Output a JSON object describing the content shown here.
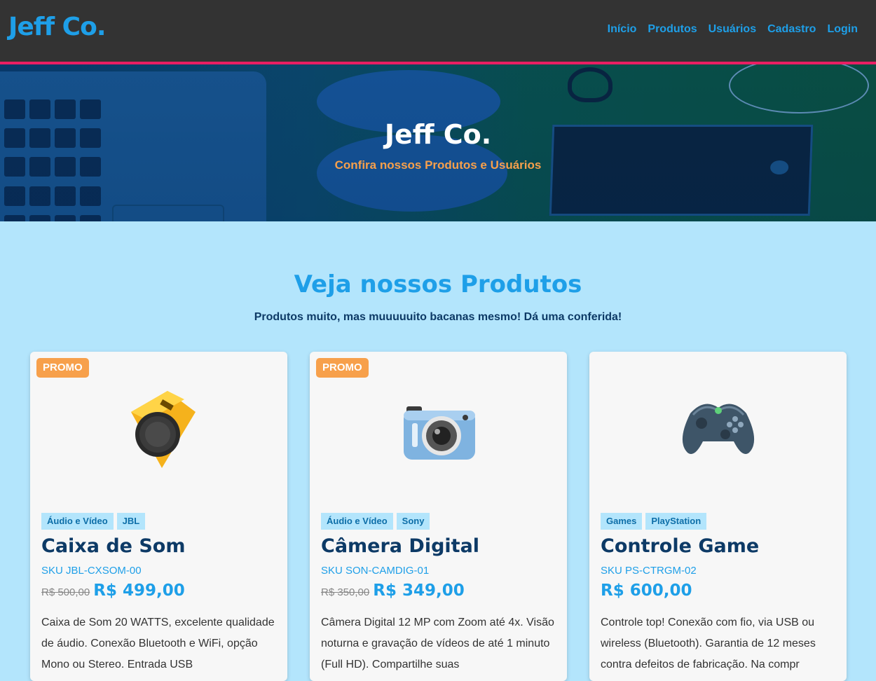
{
  "brand": "Jeff Co.",
  "nav": [
    "Início",
    "Produtos",
    "Usuários",
    "Cadastro",
    "Login"
  ],
  "hero": {
    "title": "Jeff Co.",
    "subtitle": "Confira nossos Produtos e Usuários"
  },
  "section": {
    "title": "Veja nossos Produtos",
    "subtitle": "Produtos muito, mas muuuuuito bacanas mesmo! Dá uma conferida!"
  },
  "products": [
    {
      "promo": "PROMO",
      "image_icon": "speaker-icon",
      "tags": [
        "Áudio e Vídeo",
        "JBL"
      ],
      "name": "Caixa de Som",
      "sku": "SKU JBL-CXSOM-00",
      "old_price": "R$ 500,00",
      "price": "R$ 499,00",
      "description": "Caixa de Som 20 WATTS, excelente qualidade de áudio. Conexão Bluetooth e WiFi, opção Mono ou Stereo. Entrada USB"
    },
    {
      "promo": "PROMO",
      "image_icon": "camera-icon",
      "tags": [
        "Áudio e Vídeo",
        "Sony"
      ],
      "name": "Câmera Digital",
      "sku": "SKU SON-CAMDIG-01",
      "old_price": "R$ 350,00",
      "price": "R$ 349,00",
      "description": "Câmera Digital 12 MP com Zoom até 4x. Visão noturna e gravação de vídeos de até 1 minuto (Full HD). Compartilhe suas"
    },
    {
      "promo": "",
      "image_icon": "gamepad-icon",
      "tags": [
        "Games",
        "PlayStation"
      ],
      "name": "Controle Game",
      "sku": "SKU PS-CTRGM-02",
      "old_price": "",
      "price": "R$ 600,00",
      "description": "Controle top! Conexão com fio, via USB ou wireless (Bluetooth). Garantia de 12 meses contra defeitos de fabricação. Na compr"
    }
  ],
  "colors": {
    "navbar_bg": "#333333",
    "accent_line": "#e91e63",
    "brand_blue": "#1e9fe8",
    "promo_orange": "#f7a04b",
    "page_bg": "#b3e5fc"
  }
}
